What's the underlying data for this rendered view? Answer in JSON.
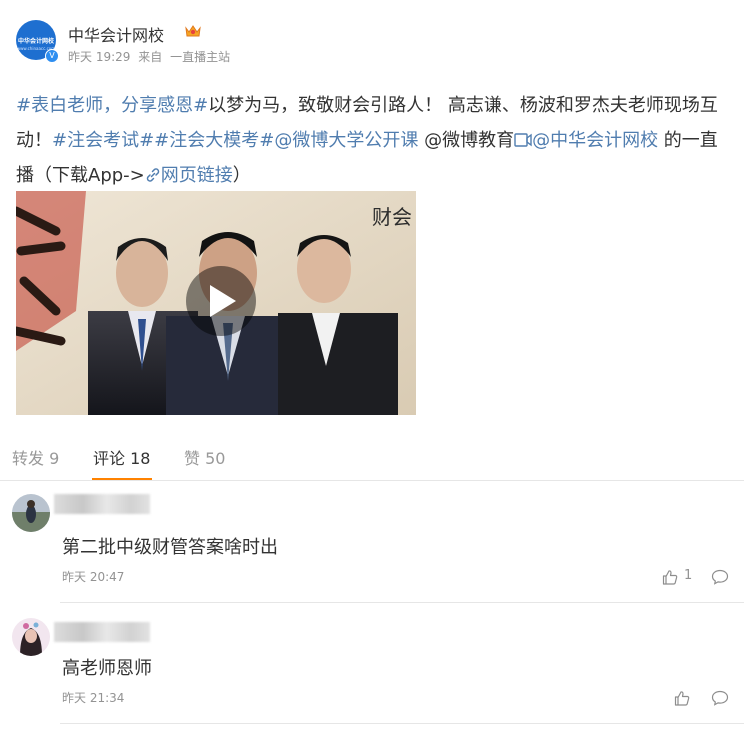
{
  "post": {
    "username": "中华会计网校",
    "avatar_text": "中华会计网校",
    "avatar_sub": "www.chinaacc.com",
    "verified_icon": "verified-badge-icon",
    "meta_time": "昨天 19:29",
    "meta_source_prefix": "来自",
    "meta_source": "一直播主站",
    "text_segments": {
      "tag1": "#表白老师，分享感恩#",
      "t1": "以梦为马，致敬财会引路人！ 高志谦、杨波和罗杰夫老师现场互动！",
      "tag2": "#注会考试#",
      "tag3": "#注会大模考#",
      "mention1": "@微博大学公开课",
      "t2": " @微博教育",
      "mention2": "@中华会计网校",
      "t3": " 的一直播（下载App->",
      "weblink": "网页链接",
      "t4": "）"
    },
    "video": {
      "caption": "财会",
      "left_calligraphy": "梦马"
    }
  },
  "tabs": {
    "repost": "转发 9",
    "comment": "评论 18",
    "like": "赞 50"
  },
  "comments": [
    {
      "text": "第二批中级财管答案啥时出",
      "time": "昨天 20:47",
      "likes": "1"
    },
    {
      "text": "高老师恩师",
      "time": "昨天 21:34",
      "likes": ""
    }
  ],
  "colors": {
    "link": "#507daf",
    "accent": "#ff8200",
    "meta": "#939393"
  }
}
